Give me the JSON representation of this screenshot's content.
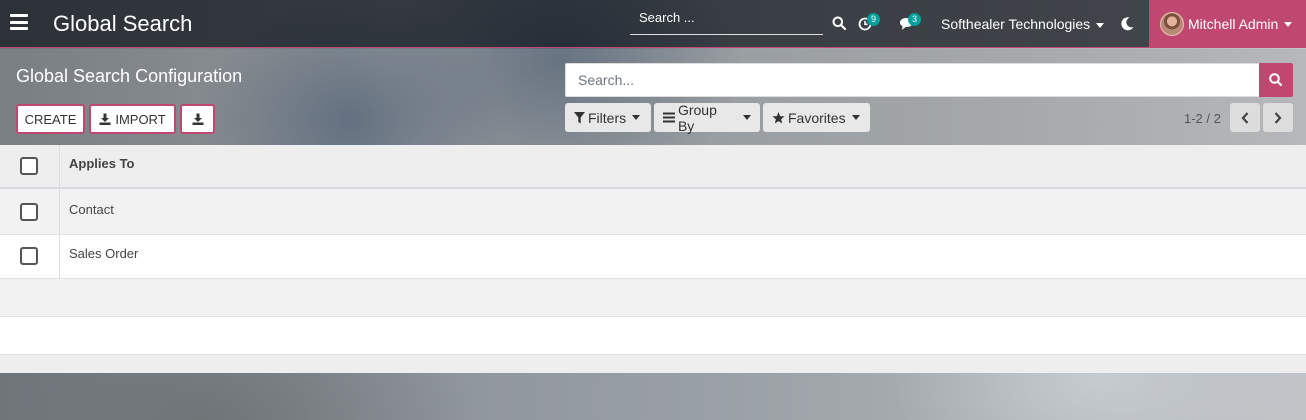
{
  "navbar": {
    "title": "Global Search",
    "search_placeholder": "Search ...",
    "activity_count": "9",
    "message_count": "3",
    "company": "Softhealer Technologies",
    "user": "Mitchell Admin"
  },
  "control_panel": {
    "breadcrumb": "Global Search Configuration",
    "create_label": "CREATE",
    "import_label": "IMPORT",
    "search_placeholder": "Search...",
    "filters_label": "Filters",
    "groupby_label": "Group By",
    "favorites_label": "Favorites",
    "pager": "1-2 / 2"
  },
  "list": {
    "header": "Applies To",
    "rows": [
      "Contact",
      "Sales Order"
    ]
  },
  "colors": {
    "accent": "#c0476f",
    "badge": "#00a09d"
  },
  "icons": [
    "hamburger-icon",
    "search-icon",
    "clock-icon",
    "chat-icon",
    "moon-icon",
    "download-icon",
    "filter-icon",
    "list-icon",
    "star-icon",
    "chevron-left-icon",
    "chevron-right-icon"
  ]
}
